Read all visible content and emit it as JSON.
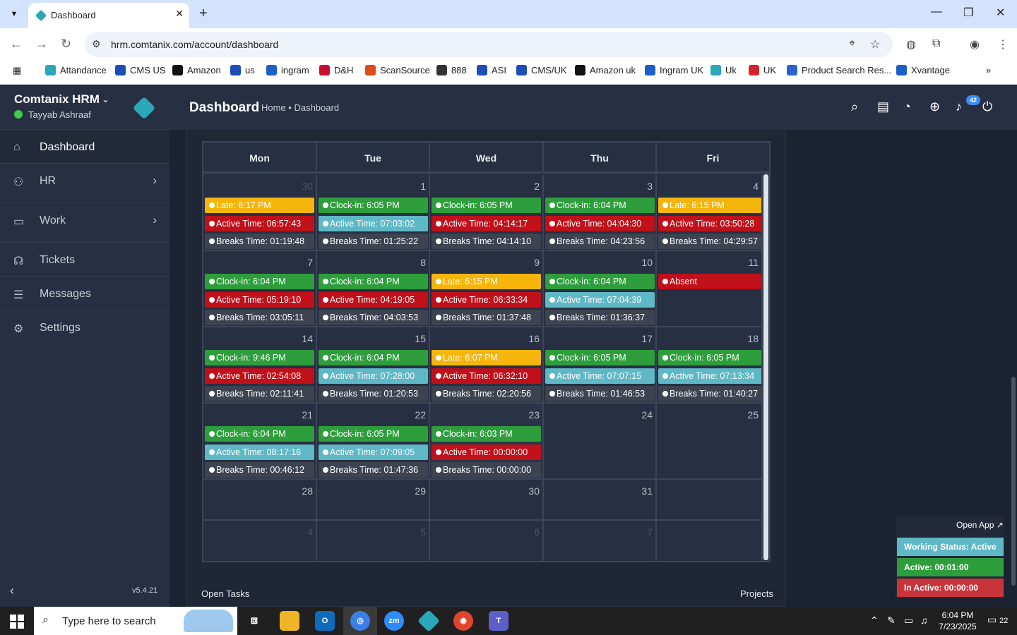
{
  "browser": {
    "tab_title": "Dashboard",
    "url": "hrm.comtanix.com/account/dashboard",
    "bookmarks": [
      {
        "label": "Attandance",
        "color": "#2aa7b8"
      },
      {
        "label": "CMS US",
        "color": "#1a4fb5"
      },
      {
        "label": "Amazon",
        "color": "#111111"
      },
      {
        "label": "us",
        "color": "#1a4fb5"
      },
      {
        "label": "ingram",
        "color": "#1a60c8"
      },
      {
        "label": "D&H",
        "color": "#c8102e"
      },
      {
        "label": "ScanSource",
        "color": "#e04b1a"
      },
      {
        "label": "888",
        "color": "#333333"
      },
      {
        "label": "ASI",
        "color": "#1a4fb5"
      },
      {
        "label": "CMS/UK",
        "color": "#1a4fb5"
      },
      {
        "label": "Amazon uk",
        "color": "#111111"
      },
      {
        "label": "Ingram UK",
        "color": "#1a60c8"
      },
      {
        "label": "Uk",
        "color": "#2aa7b8"
      },
      {
        "label": "UK",
        "color": "#d6242c"
      },
      {
        "label": "Product Search Res...",
        "color": "#2a62c9"
      },
      {
        "label": "Xvantage",
        "color": "#1a60c8"
      }
    ]
  },
  "sidebar": {
    "brand": "Comtanix HRM",
    "user": "Tayyab Ashraaf",
    "items": [
      {
        "label": "Dashboard",
        "icon": "home-icon",
        "active": true
      },
      {
        "label": "HR",
        "icon": "users-icon",
        "arrow": "›"
      },
      {
        "label": "Work",
        "icon": "briefcase-icon",
        "arrow": "›"
      },
      {
        "label": "Tickets",
        "icon": "headset-icon"
      },
      {
        "label": "Messages",
        "icon": "message-icon"
      },
      {
        "label": "Settings",
        "icon": "gear-icon"
      }
    ],
    "collapse": "‹",
    "version": "v5.4.21"
  },
  "header": {
    "title": "Dashboard",
    "breadcrumb": "Home • Dashboard",
    "notification_count": "42"
  },
  "calendar": {
    "days": [
      "Mon",
      "Tue",
      "Wed",
      "Thu",
      "Fri"
    ],
    "weeks": [
      [
        {
          "n": "30",
          "muted": true,
          "events": [
            [
              "yellow",
              "Late: 6:17 PM"
            ],
            [
              "red",
              "Active Time: 06:57:43"
            ],
            [
              "gray",
              "Breaks Time: 01:19:48"
            ]
          ]
        },
        {
          "n": "1",
          "events": [
            [
              "green",
              "Clock-in: 6:05 PM"
            ],
            [
              "blue",
              "Active Time: 07:03:02"
            ],
            [
              "gray",
              "Breaks Time: 01:25:22"
            ]
          ]
        },
        {
          "n": "2",
          "events": [
            [
              "green",
              "Clock-in: 6:05 PM"
            ],
            [
              "red",
              "Active Time: 04:14:17"
            ],
            [
              "gray",
              "Breaks Time: 04:14:10"
            ]
          ]
        },
        {
          "n": "3",
          "events": [
            [
              "green",
              "Clock-in: 6:04 PM"
            ],
            [
              "red",
              "Active Time: 04:04:30"
            ],
            [
              "gray",
              "Breaks Time: 04:23:56"
            ]
          ]
        },
        {
          "n": "4",
          "events": [
            [
              "yellow",
              "Late: 6:15 PM"
            ],
            [
              "red",
              "Active Time: 03:50:28"
            ],
            [
              "gray",
              "Breaks Time: 04:29:57"
            ]
          ]
        }
      ],
      [
        {
          "n": "7",
          "events": [
            [
              "green",
              "Clock-in: 6:04 PM"
            ],
            [
              "red",
              "Active Time: 05:19:10"
            ],
            [
              "gray",
              "Breaks Time: 03:05:11"
            ]
          ]
        },
        {
          "n": "8",
          "events": [
            [
              "green",
              "Clock-in: 6:04 PM"
            ],
            [
              "red",
              "Active Time: 04:19:05"
            ],
            [
              "gray",
              "Breaks Time: 04:03:53"
            ]
          ]
        },
        {
          "n": "9",
          "events": [
            [
              "yellow",
              "Late: 6:15 PM"
            ],
            [
              "red",
              "Active Time: 06:33:34"
            ],
            [
              "gray",
              "Breaks Time: 01:37:48"
            ]
          ]
        },
        {
          "n": "10",
          "events": [
            [
              "green",
              "Clock-in: 6:04 PM"
            ],
            [
              "blue",
              "Active Time: 07:04:39"
            ],
            [
              "gray",
              "Breaks Time: 01:36:37"
            ]
          ]
        },
        {
          "n": "11",
          "events": [
            [
              "red",
              "Absent"
            ]
          ]
        }
      ],
      [
        {
          "n": "14",
          "events": [
            [
              "green",
              "Clock-in: 9:46 PM"
            ],
            [
              "red",
              "Active Time: 02:54:08"
            ],
            [
              "gray",
              "Breaks Time: 02:11:41"
            ]
          ]
        },
        {
          "n": "15",
          "events": [
            [
              "green",
              "Clock-in: 6:04 PM"
            ],
            [
              "blue",
              "Active Time: 07:28:00"
            ],
            [
              "gray",
              "Breaks Time: 01:20:53"
            ]
          ]
        },
        {
          "n": "16",
          "events": [
            [
              "yellow",
              "Late: 6:07 PM"
            ],
            [
              "red",
              "Active Time: 06:32:10"
            ],
            [
              "gray",
              "Breaks Time: 02:20:56"
            ]
          ]
        },
        {
          "n": "17",
          "events": [
            [
              "green",
              "Clock-in: 6:05 PM"
            ],
            [
              "blue",
              "Active Time: 07:07:15"
            ],
            [
              "gray",
              "Breaks Time: 01:46:53"
            ]
          ]
        },
        {
          "n": "18",
          "events": [
            [
              "green",
              "Clock-in: 6:05 PM"
            ],
            [
              "blue",
              "Active Time: 07:13:34"
            ],
            [
              "gray",
              "Breaks Time: 01:40:27"
            ]
          ]
        }
      ],
      [
        {
          "n": "21",
          "events": [
            [
              "green",
              "Clock-in: 6:04 PM"
            ],
            [
              "blue",
              "Active Time: 08:17:16"
            ],
            [
              "gray",
              "Breaks Time: 00:46:12"
            ]
          ]
        },
        {
          "n": "22",
          "events": [
            [
              "green",
              "Clock-in: 6:05 PM"
            ],
            [
              "blue",
              "Active Time: 07:09:05"
            ],
            [
              "gray",
              "Breaks Time: 01:47:36"
            ]
          ]
        },
        {
          "n": "23",
          "today": true,
          "events": [
            [
              "green",
              "Clock-in: 6:03 PM"
            ],
            [
              "red",
              "Active Time: 00:00:00"
            ],
            [
              "gray",
              "Breaks Time: 00:00:00"
            ]
          ]
        },
        {
          "n": "24",
          "events": []
        },
        {
          "n": "25",
          "events": []
        }
      ],
      [
        {
          "n": "28",
          "events": []
        },
        {
          "n": "29",
          "events": []
        },
        {
          "n": "30",
          "events": []
        },
        {
          "n": "31",
          "events": []
        },
        {
          "n": "",
          "events": []
        }
      ],
      [
        {
          "n": "4",
          "muted": true,
          "events": []
        },
        {
          "n": "5",
          "muted": true,
          "events": []
        },
        {
          "n": "6",
          "muted": true,
          "events": []
        },
        {
          "n": "7",
          "muted": true,
          "events": []
        },
        {
          "n": "",
          "muted": true,
          "events": []
        }
      ]
    ]
  },
  "colors": {
    "green": "#2e9e3c",
    "yellow": "#f5b50b",
    "red": "#c0101a",
    "blue": "#5fb8c6",
    "gray": "#3d4351"
  },
  "footer": {
    "left": "Open Tasks",
    "right": "Projects"
  },
  "widget": {
    "open_app": "Open App ↗",
    "status": "Working Status: Active",
    "active": "Active: 00:01:00",
    "inactive": "In Active: 00:00:00"
  },
  "taskbar": {
    "search_placeholder": "Type here to search",
    "time": "6:04 PM",
    "date": "7/23/2025",
    "notifications": "22"
  }
}
